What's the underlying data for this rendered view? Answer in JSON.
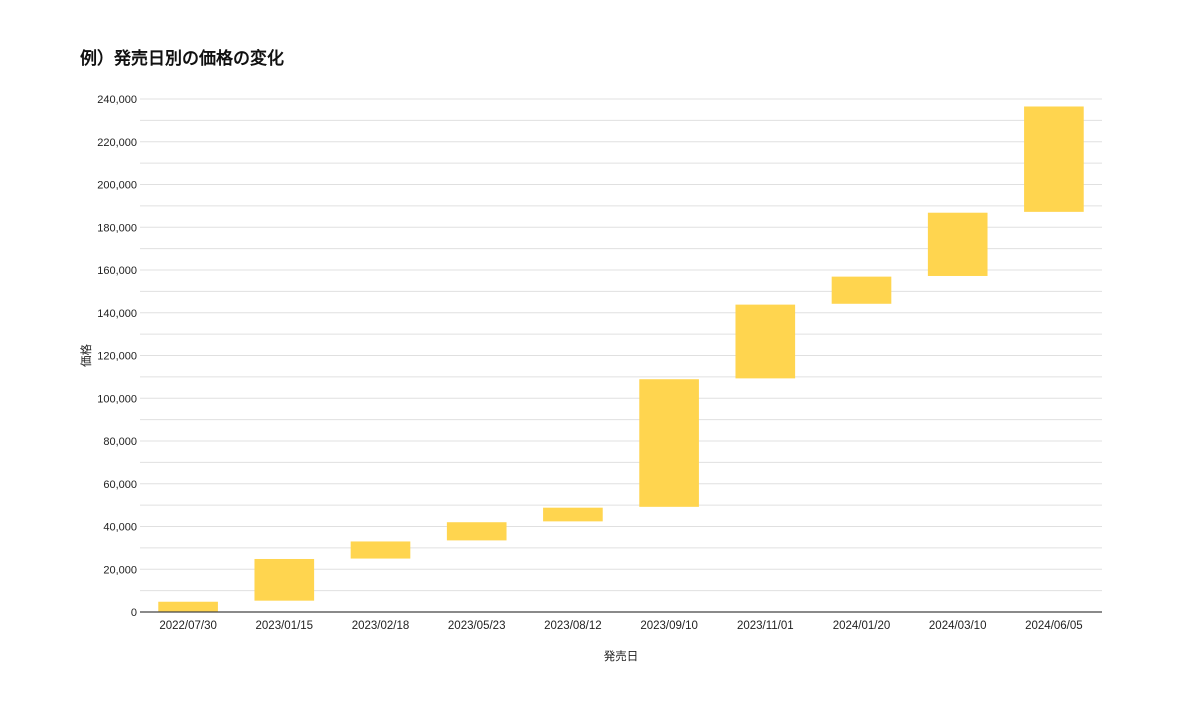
{
  "chart_data": {
    "type": "waterfall",
    "title": "例）発売日別の価格の変化",
    "xlabel": "発売日",
    "ylabel": "価格",
    "ylim": [
      0,
      240000
    ],
    "y_ticks": [
      0,
      20000,
      40000,
      60000,
      80000,
      100000,
      120000,
      140000,
      160000,
      180000,
      200000,
      220000,
      240000
    ],
    "y_tick_labels": [
      "0",
      "20,000",
      "40,000",
      "60,000",
      "80,000",
      "100,000",
      "120,000",
      "140,000",
      "160,000",
      "180,000",
      "200,000",
      "220,000",
      "240,000"
    ],
    "minor_grid_step": 10000,
    "grid": true,
    "categories": [
      "2022/07/30",
      "2023/01/15",
      "2023/02/18",
      "2023/05/23",
      "2023/08/12",
      "2023/09/10",
      "2023/11/01",
      "2024/01/20",
      "2024/03/10",
      "2024/06/05"
    ],
    "bars": [
      {
        "start": 0,
        "end": 4800
      },
      {
        "start": 5300,
        "end": 24800
      },
      {
        "start": 25000,
        "end": 33000
      },
      {
        "start": 33500,
        "end": 42000
      },
      {
        "start": 42400,
        "end": 48800
      },
      {
        "start": 49200,
        "end": 108900
      },
      {
        "start": 109300,
        "end": 143800
      },
      {
        "start": 144200,
        "end": 156900
      },
      {
        "start": 157200,
        "end": 186800
      },
      {
        "start": 187200,
        "end": 236500
      }
    ],
    "colors": {
      "bar": "#FFD54F",
      "grid": "#e0e0e0",
      "axis": "#444444"
    }
  }
}
